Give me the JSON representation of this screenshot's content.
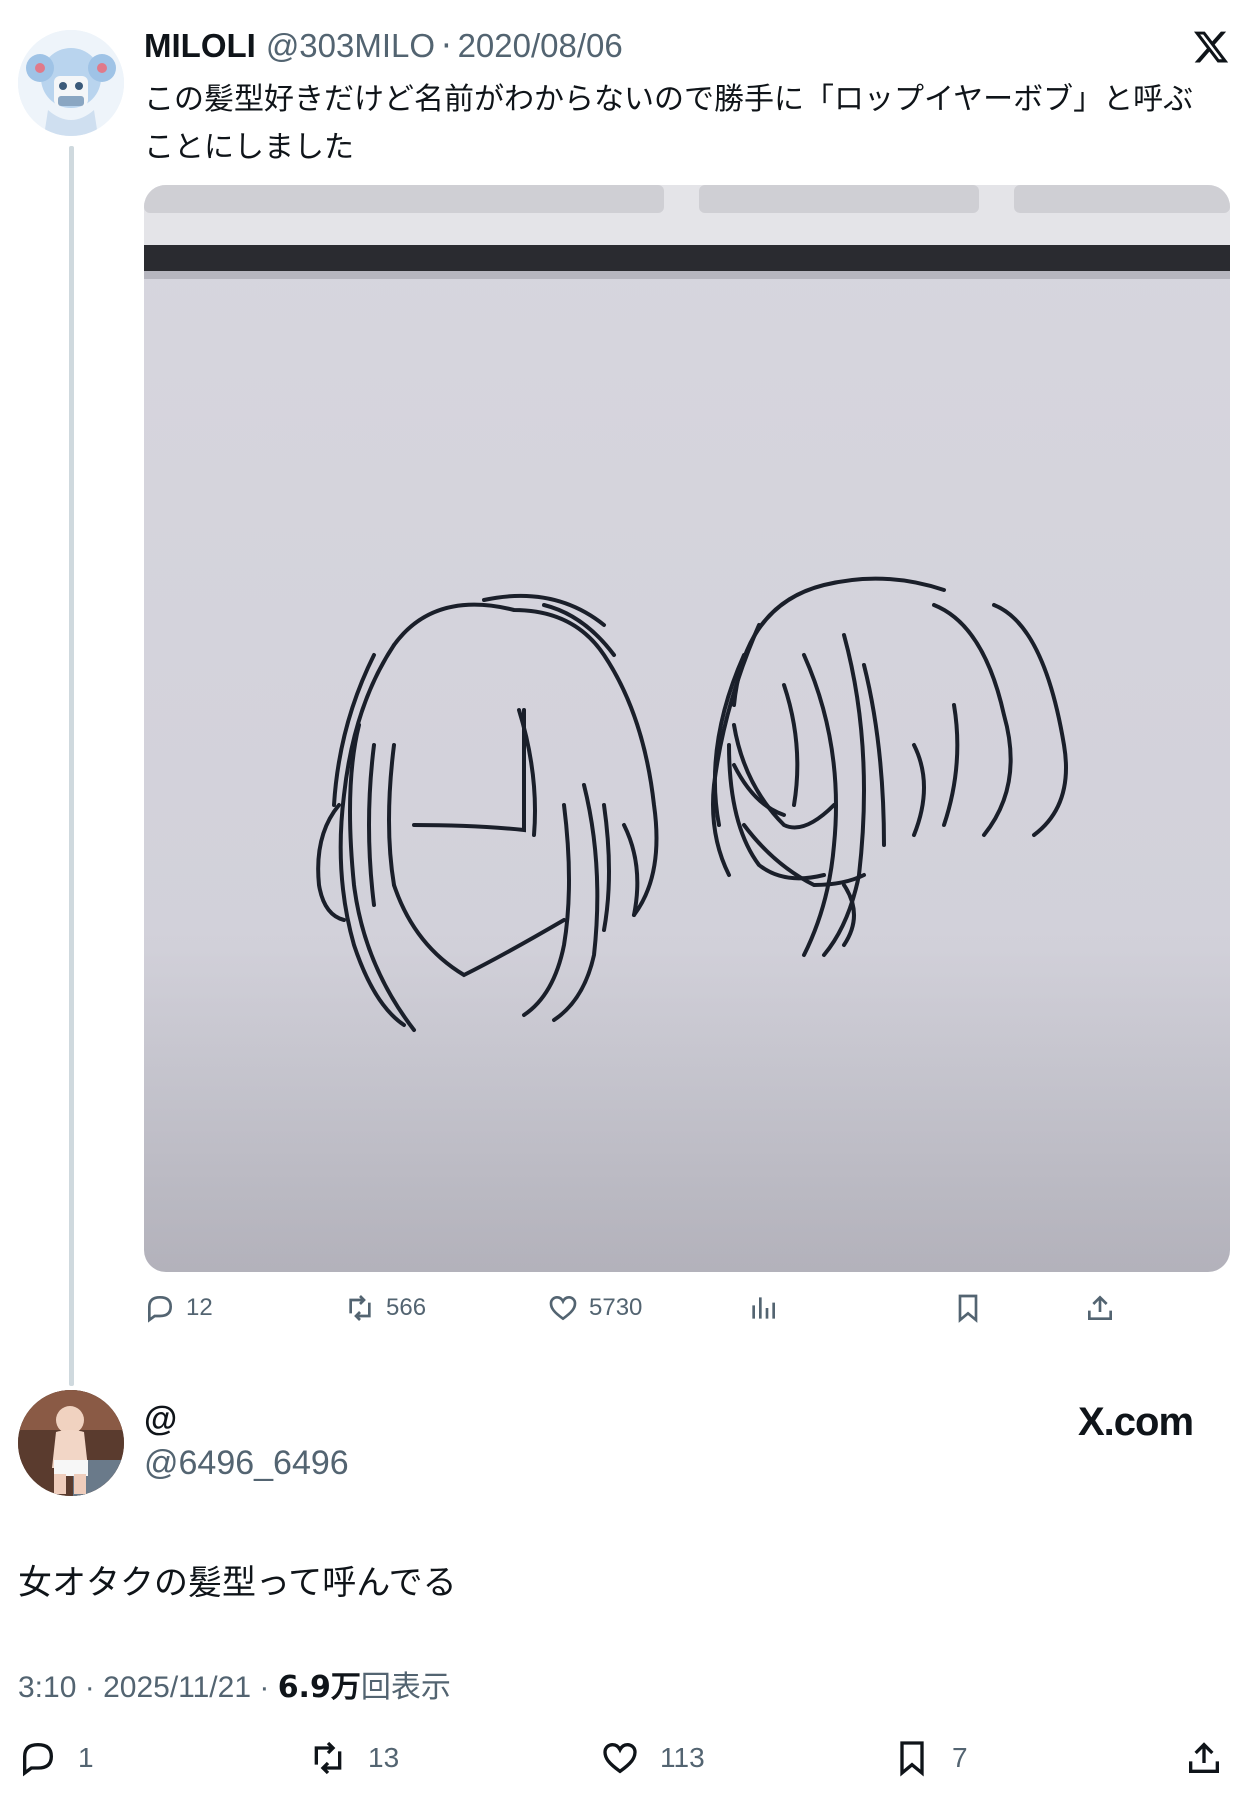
{
  "quoted_tweet": {
    "display_name": "MILOLI",
    "handle": "@303MILO",
    "separator": "·",
    "date": "2020/08/06",
    "text_line1": "この髪型好きだけど名前がわからないので勝手に「ロップイヤーボブ」と呼ぶ",
    "text_line2": "ことにしました",
    "stats": {
      "replies": "12",
      "retweets": "566",
      "likes": "5730"
    }
  },
  "reply_tweet": {
    "display_name": "@",
    "handle": "@6496_6496",
    "brand": "X.com",
    "text": "女オタクの髪型って呼んでる",
    "time": "3:10",
    "date": "2025/11/21",
    "views_count": "6.9万",
    "views_label": "回表示",
    "separator": "·",
    "stats": {
      "replies": "1",
      "retweets": "13",
      "likes": "113",
      "bookmarks": "7"
    }
  },
  "colors": {
    "text": "#0f1419",
    "muted": "#536471",
    "thread_line": "#cfd9de"
  },
  "icons": [
    "x-logo-icon",
    "reply-icon",
    "retweet-icon",
    "like-icon",
    "views-icon",
    "bookmark-icon",
    "share-icon"
  ]
}
